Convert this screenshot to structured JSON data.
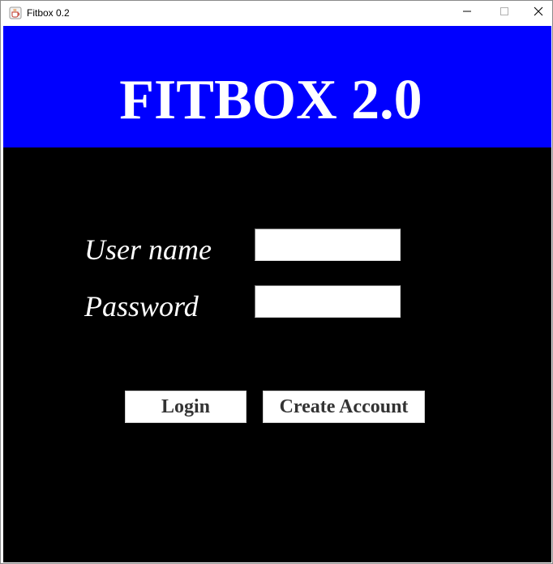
{
  "window": {
    "title": "Fitbox 0.2",
    "minimize_symbol": "—",
    "maximize_symbol": "☐",
    "close_symbol": "✕",
    "app_icon": "java-cup-icon"
  },
  "banner": {
    "title": "FITBOX 2.0",
    "color": "#0000ff"
  },
  "form": {
    "username_label": "User name",
    "username_value": "",
    "password_label": "Password",
    "password_value": ""
  },
  "actions": {
    "login_label": "Login",
    "create_account_label": "Create Account"
  },
  "colors": {
    "background": "#000000",
    "banner": "#0000ff",
    "text": "#ffffff"
  }
}
